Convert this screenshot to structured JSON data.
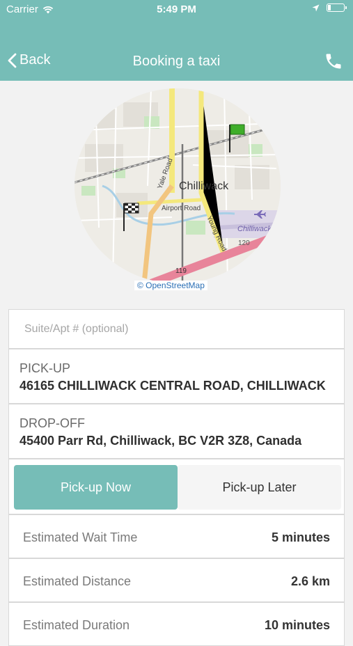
{
  "status_bar": {
    "carrier": "Carrier",
    "time": "5:49 PM"
  },
  "nav": {
    "back_label": "Back",
    "title": "Booking a taxi",
    "phone_icon": "phone-icon"
  },
  "map": {
    "city_label": "Chilliwack",
    "road_labels": [
      "Yale Road",
      "Airport Road",
      "Young Road"
    ],
    "airport_label": "Chilliwack Airport",
    "highway_number": "119",
    "route_number": "120",
    "attribution": "© OpenStreetMap"
  },
  "form": {
    "suite_placeholder": "Suite/Apt # (optional)",
    "pickup_label": "PICK-UP",
    "pickup_value": "46165 CHILLIWACK CENTRAL ROAD, CHILLIWACK",
    "dropoff_label": "DROP-OFF",
    "dropoff_value": "45400 Parr Rd, Chilliwack, BC V2R 3Z8, Canada"
  },
  "timing": {
    "now_label": "Pick-up Now",
    "later_label": "Pick-up Later",
    "selected": "now"
  },
  "estimates": [
    {
      "label": "Estimated Wait Time",
      "value": "5 minutes"
    },
    {
      "label": "Estimated Distance",
      "value": "2.6 km"
    },
    {
      "label": "Estimated Duration",
      "value": "10 minutes"
    }
  ],
  "colors": {
    "accent": "#76bdb7",
    "background": "#f2f2f2"
  }
}
